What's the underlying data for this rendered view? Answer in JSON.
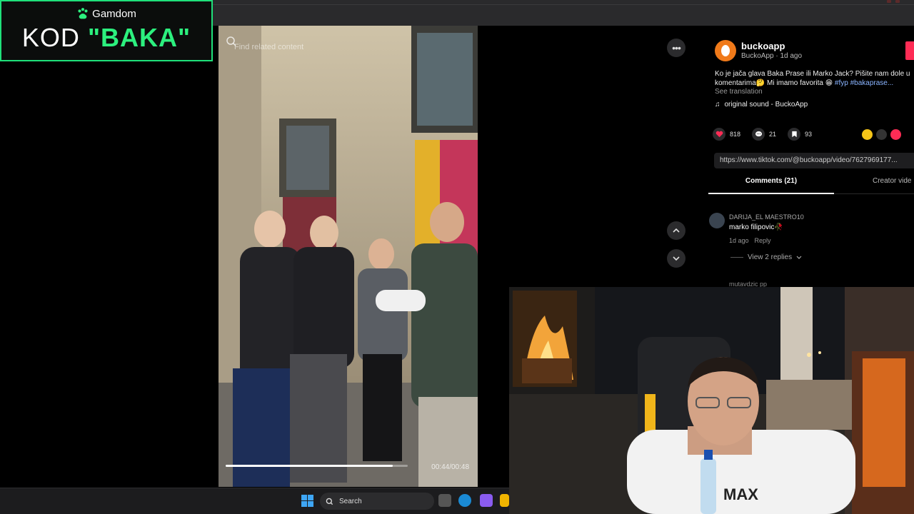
{
  "overlay": {
    "brand": "Gamdom",
    "code_prefix": "KOD ",
    "code_value": "\"BAKA\"",
    "accent": "#2cf07e"
  },
  "video": {
    "search_placeholder": "Find related content",
    "timecode": "00:44/00:48",
    "progress_fraction": 0.917
  },
  "post": {
    "username": "buckoapp",
    "submeta": "BuckoApp · 1d ago",
    "caption_line1": "Ko je jača glava Baka Prase ili Marko Jack? Pišite nam dole u",
    "caption_line2_text": "komentarima🤔 Mi imamo favorita 😁 ",
    "caption_tags": "#fyp #bakaprase...",
    "see_translation": "See translation",
    "music": "original sound - BuckoApp",
    "likes": "818",
    "comments_count": "21",
    "saves": "93",
    "url": "https://www.tiktok.com/@buckoapp/video/7627969177...",
    "accent": "#fe2c55"
  },
  "tabs": {
    "comments": "Comments (21)",
    "creator": "Creator vide"
  },
  "comment": {
    "user": "DARIJA_EL MAESTRO10",
    "text": "marko filipovic🥀",
    "time": "1d ago",
    "reply": "Reply",
    "view_replies": "View 2 replies",
    "next_user": "mutavdzic pp"
  },
  "taskbar": {
    "search_label": "Search"
  },
  "icons": {
    "more": "more-horizontal-icon",
    "up": "chevron-up-icon",
    "down": "chevron-down-icon",
    "like": "heart-icon",
    "comment": "comment-icon",
    "save": "bookmark-icon",
    "music": "music-note-icon",
    "windows": "windows-start-icon",
    "search": "search-icon"
  }
}
